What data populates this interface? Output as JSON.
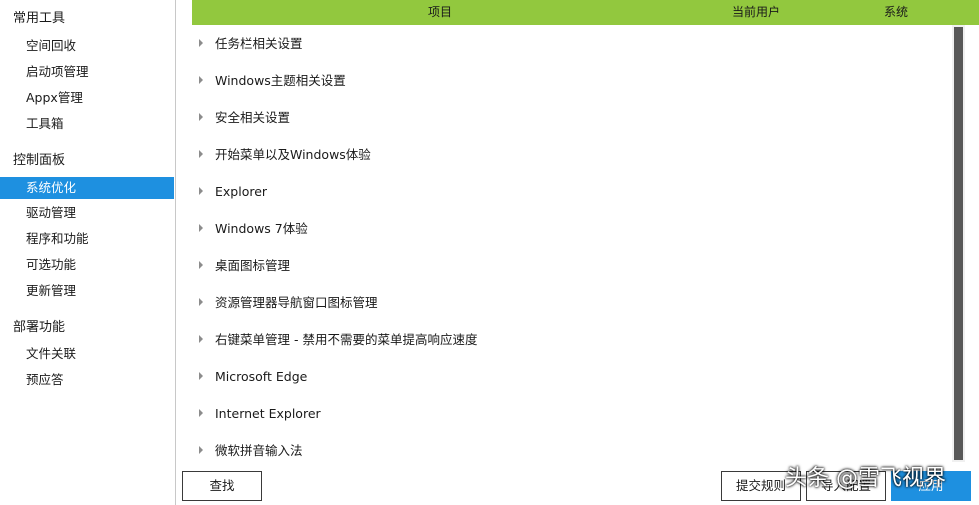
{
  "sidebar": {
    "groups": [
      {
        "label": "常用工具",
        "items": [
          "空间回收",
          "启动项管理",
          "Appx管理",
          "工具箱"
        ]
      },
      {
        "label": "控制面板",
        "items": [
          "系统优化",
          "驱动管理",
          "程序和功能",
          "可选功能",
          "更新管理"
        ]
      },
      {
        "label": "部署功能",
        "items": [
          "文件关联",
          "预应答"
        ]
      }
    ],
    "active_item": "系统优化"
  },
  "table": {
    "headers": {
      "item": "项目",
      "current_user": "当前用户",
      "system": "系统"
    },
    "rows": [
      "任务栏相关设置",
      "Windows主题相关设置",
      "安全相关设置",
      "开始菜单以及Windows体验",
      "Explorer",
      "Windows 7体验",
      "桌面图标管理",
      "资源管理器导航窗口图标管理",
      "右键菜单管理 - 禁用不需要的菜单提高响应速度",
      "Microsoft Edge",
      "Internet Explorer",
      "微软拼音输入法"
    ]
  },
  "buttons": {
    "search": "查找",
    "submit_rules": "提交规则",
    "import_config": "导入配置",
    "apply": "应用"
  },
  "watermark": "头条 @雪飞视界",
  "colors": {
    "header_bg": "#92c83e",
    "accent": "#1e90e0"
  }
}
